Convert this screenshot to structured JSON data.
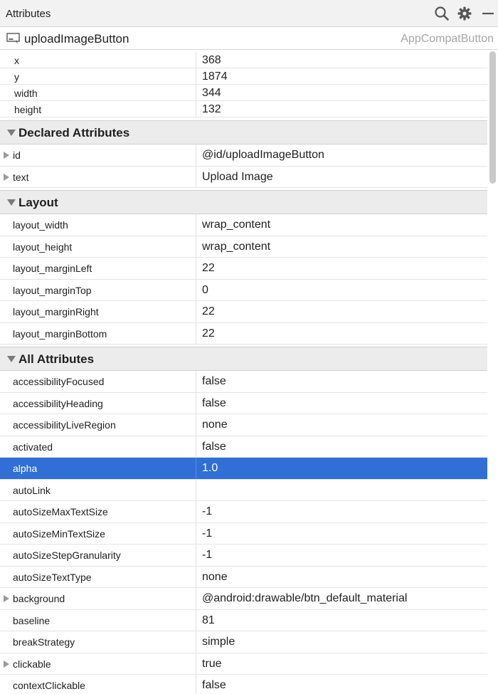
{
  "window": {
    "title": "Attributes"
  },
  "toolbar": {
    "icons": [
      "search-icon",
      "gear-icon",
      "minimize-icon"
    ]
  },
  "component": {
    "name": "uploadImageButton",
    "type": "AppCompatButton"
  },
  "geometry": {
    "rows": [
      {
        "label": "x",
        "value": "368"
      },
      {
        "label": "y",
        "value": "1874"
      },
      {
        "label": "width",
        "value": "344"
      },
      {
        "label": "height",
        "value": "132"
      }
    ]
  },
  "declared": {
    "title": "Declared Attributes",
    "rows": [
      {
        "label": "id",
        "value": "@id/uploadImageButton",
        "expandable": true
      },
      {
        "label": "text",
        "value": "Upload Image",
        "expandable": true
      }
    ]
  },
  "layout": {
    "title": "Layout",
    "rows": [
      {
        "label": "layout_width",
        "value": "wrap_content"
      },
      {
        "label": "layout_height",
        "value": "wrap_content"
      },
      {
        "label": "layout_marginLeft",
        "value": "22"
      },
      {
        "label": "layout_marginTop",
        "value": "0"
      },
      {
        "label": "layout_marginRight",
        "value": "22"
      },
      {
        "label": "layout_marginBottom",
        "value": "22"
      }
    ]
  },
  "all": {
    "title": "All Attributes",
    "selected_index": 4,
    "rows": [
      {
        "label": "accessibilityFocused",
        "value": "false"
      },
      {
        "label": "accessibilityHeading",
        "value": "false"
      },
      {
        "label": "accessibilityLiveRegion",
        "value": "none"
      },
      {
        "label": "activated",
        "value": "false"
      },
      {
        "label": "alpha",
        "value": "1.0"
      },
      {
        "label": "autoLink",
        "value": ""
      },
      {
        "label": "autoSizeMaxTextSize",
        "value": "-1"
      },
      {
        "label": "autoSizeMinTextSize",
        "value": "-1"
      },
      {
        "label": "autoSizeStepGranularity",
        "value": "-1"
      },
      {
        "label": "autoSizeTextType",
        "value": "none"
      },
      {
        "label": "background",
        "value": "@android:drawable/btn_default_material",
        "expandable": true
      },
      {
        "label": "baseline",
        "value": "81"
      },
      {
        "label": "breakStrategy",
        "value": "simple"
      },
      {
        "label": "clickable",
        "value": "true",
        "expandable": true
      },
      {
        "label": "contextClickable",
        "value": "false"
      }
    ]
  },
  "colors": {
    "selection": "#2f6fd6",
    "section_bg": "#ececec",
    "type_text": "#a6a6a6"
  }
}
